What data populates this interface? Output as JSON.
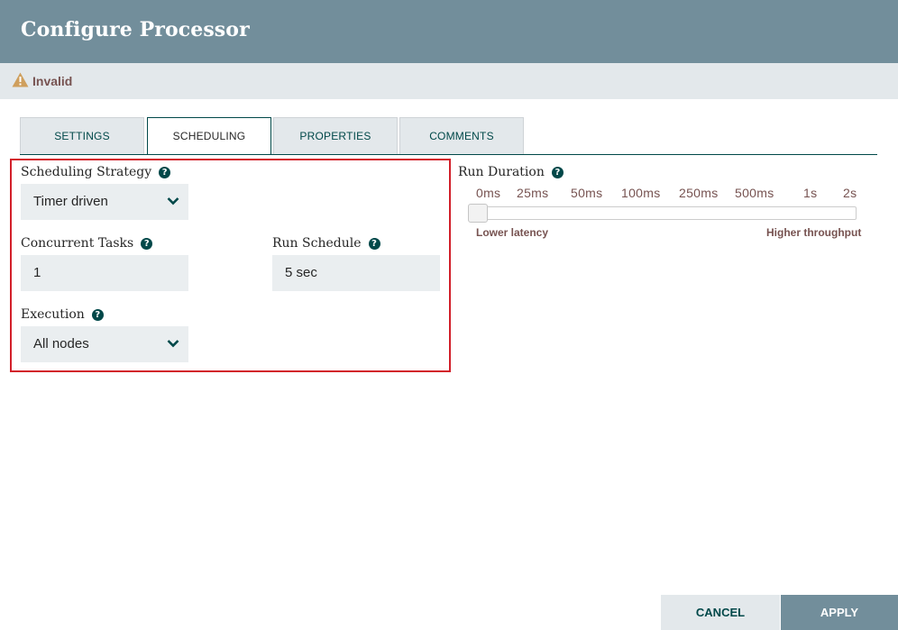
{
  "dialog": {
    "title": "Configure Processor"
  },
  "status": {
    "icon": "warning-icon",
    "text": "Invalid"
  },
  "tabs": [
    {
      "label": "SETTINGS",
      "active": false
    },
    {
      "label": "SCHEDULING",
      "active": true
    },
    {
      "label": "PROPERTIES",
      "active": false
    },
    {
      "label": "COMMENTS",
      "active": false
    }
  ],
  "scheduling": {
    "strategy": {
      "label": "Scheduling Strategy",
      "value": "Timer driven"
    },
    "concurrent_tasks": {
      "label": "Concurrent Tasks",
      "value": "1"
    },
    "run_schedule": {
      "label": "Run Schedule",
      "value": "5 sec"
    },
    "execution": {
      "label": "Execution",
      "value": "All nodes"
    }
  },
  "run_duration": {
    "label": "Run Duration",
    "ticks": [
      "0ms",
      "25ms",
      "50ms",
      "100ms",
      "250ms",
      "500ms",
      "1s",
      "2s"
    ],
    "selected": "0ms",
    "low_caption": "Lower latency",
    "high_caption": "Higher throughput"
  },
  "buttons": {
    "cancel": "CANCEL",
    "apply": "APPLY"
  },
  "colors": {
    "header": "#728e9b",
    "status_bar": "#e3e8eb",
    "accent": "#004849",
    "warning_text": "#775351",
    "highlight_border": "#d21f2a"
  }
}
